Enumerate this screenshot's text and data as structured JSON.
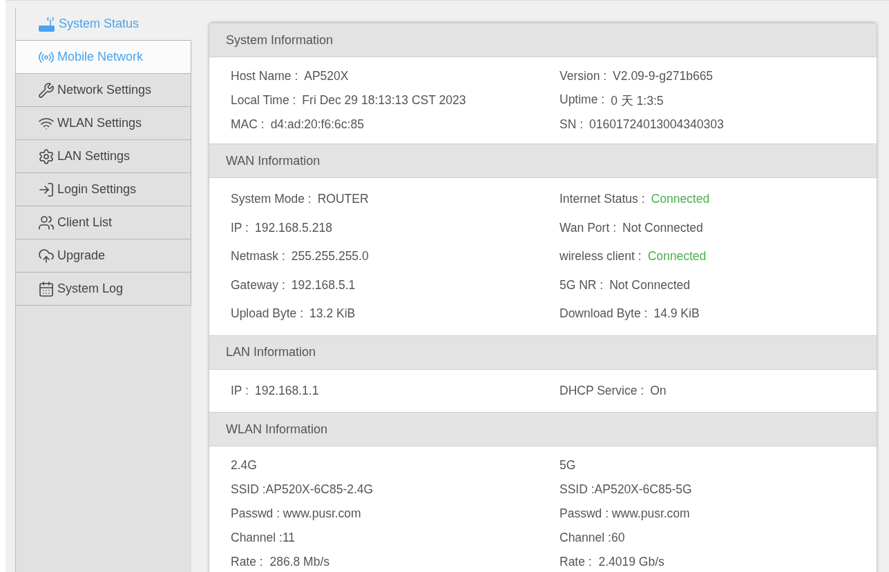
{
  "sidebar": {
    "items": [
      {
        "label": "System Status",
        "selected": true,
        "hovered": false
      },
      {
        "label": "Mobile Network",
        "selected": false,
        "hovered": true
      },
      {
        "label": "Network Settings",
        "selected": false,
        "hovered": false
      },
      {
        "label": "WLAN Settings",
        "selected": false,
        "hovered": false
      },
      {
        "label": "LAN Settings",
        "selected": false,
        "hovered": false
      },
      {
        "label": "Login Settings",
        "selected": false,
        "hovered": false
      },
      {
        "label": "Client List",
        "selected": false,
        "hovered": false
      },
      {
        "label": "Upgrade",
        "selected": false,
        "hovered": false
      },
      {
        "label": "System Log",
        "selected": false,
        "hovered": false
      }
    ]
  },
  "sections": [
    {
      "title": "System Information",
      "kind": "pairs",
      "rows": [
        [
          {
            "label": "Host Name :",
            "value": "AP520X",
            "ok": false
          },
          {
            "label": "Version :",
            "value": "V2.09-9-g271b665",
            "ok": false
          }
        ],
        [
          {
            "label": "Local Time :",
            "value": "Fri Dec 29 18:13:13 CST 2023",
            "ok": false
          },
          {
            "label": "Uptime :",
            "value": "0 天 1:3:5",
            "ok": false
          }
        ],
        [
          {
            "label": "MAC :",
            "value": "d4:ad:20:f6:6c:85",
            "ok": false
          },
          {
            "label": "SN :",
            "value": "01601724013004340303",
            "ok": false
          }
        ]
      ]
    },
    {
      "title": "WAN Information",
      "kind": "pairs-wide",
      "rows": [
        [
          {
            "label": "System Mode :",
            "value": "ROUTER",
            "ok": false
          },
          {
            "label": "Internet Status :",
            "value": "Connected",
            "ok": true
          }
        ],
        [
          {
            "label": "IP :",
            "value": "192.168.5.218",
            "ok": false
          },
          {
            "label": "Wan Port :",
            "value": "Not Connected",
            "ok": false
          }
        ],
        [
          {
            "label": "Netmask :",
            "value": "255.255.255.0",
            "ok": false
          },
          {
            "label": "wireless client :",
            "value": "Connected",
            "ok": true
          }
        ],
        [
          {
            "label": "Gateway :",
            "value": "192.168.5.1",
            "ok": false
          },
          {
            "label": "5G NR :",
            "value": "Not Connected",
            "ok": false
          }
        ],
        [
          {
            "label": "Upload Byte :",
            "value": "13.2 KiB",
            "ok": false
          },
          {
            "label": "Download Byte :",
            "value": "14.9 KiB",
            "ok": false
          }
        ]
      ]
    },
    {
      "title": "LAN Information",
      "kind": "pairs-wide",
      "rows": [
        [
          {
            "label": "IP :",
            "value": "192.168.1.1",
            "ok": false
          },
          {
            "label": "DHCP Service :",
            "value": "On",
            "ok": false
          }
        ]
      ]
    },
    {
      "title": "WLAN Information",
      "kind": "lines",
      "rows": [
        [
          "2.4G",
          "5G"
        ],
        [
          "SSID :AP520X-6C85-2.4G",
          "SSID :AP520X-6C85-5G"
        ],
        [
          "Passwd : www.pusr.com",
          "Passwd : www.pusr.com"
        ],
        [
          "Channel :11",
          "Channel :60"
        ],
        [
          "Rate :  286.8 Mb/s",
          "Rate :  2.4019 Gb/s"
        ]
      ]
    }
  ]
}
